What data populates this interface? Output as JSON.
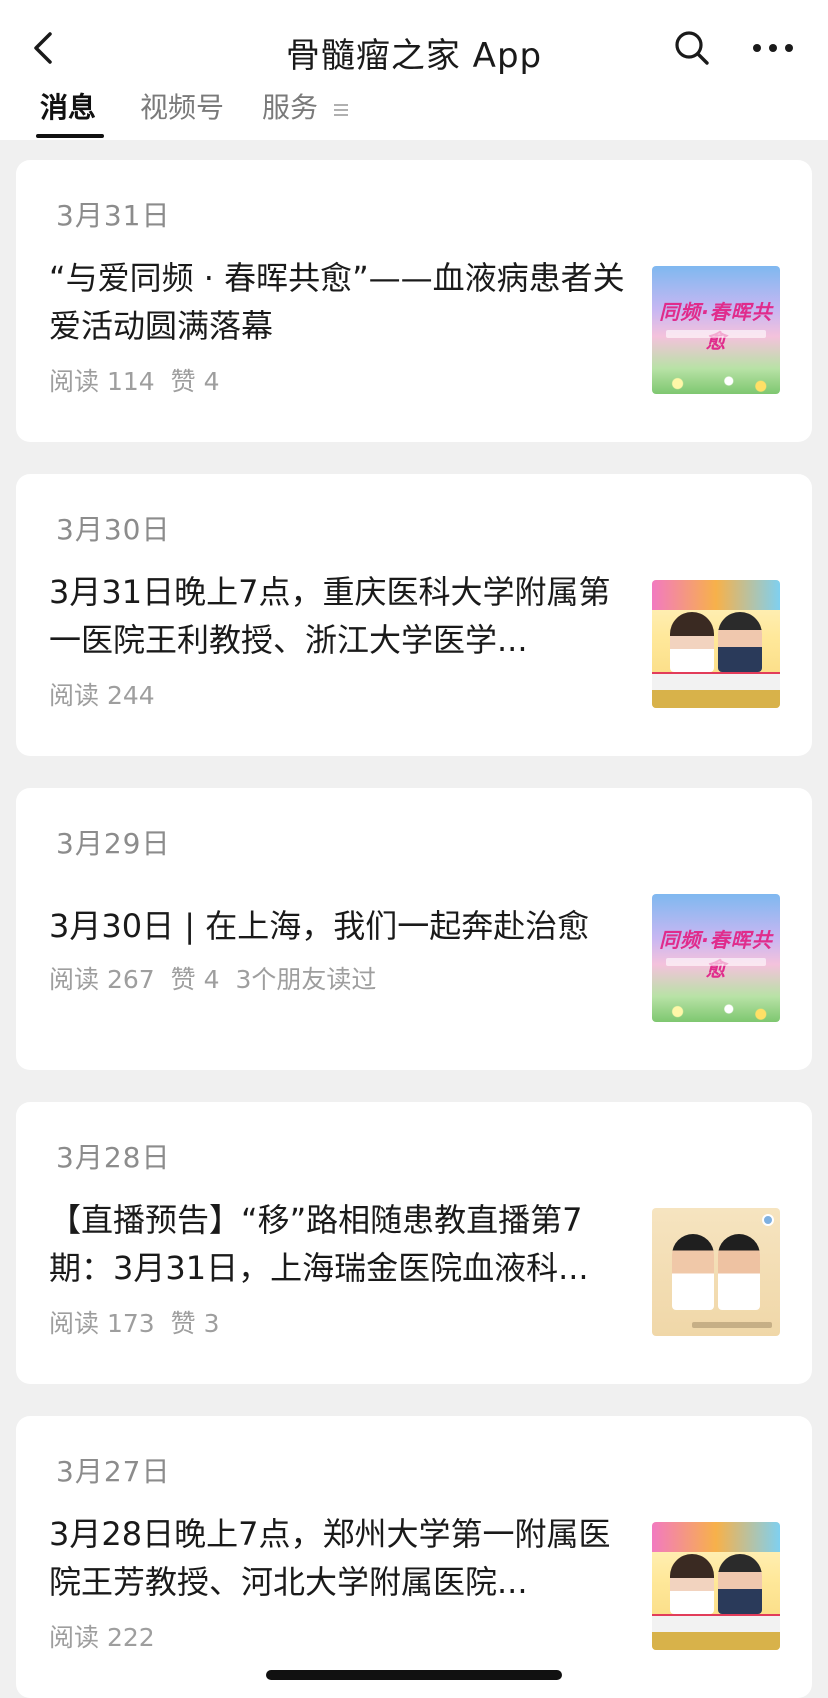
{
  "header": {
    "title": "骨髓瘤之家 App",
    "back_icon": "chevron-left-icon",
    "search_icon": "search-icon",
    "more_icon": "more-horizontal-icon"
  },
  "tabs": [
    {
      "label": "消息",
      "active": true
    },
    {
      "label": "视频号",
      "active": false
    },
    {
      "label": "服务",
      "active": false
    }
  ],
  "articles": [
    {
      "date": "3月31日",
      "title": "“与爱同频 · 春晖共愈”——血液病患者关爱活动圆满落幕",
      "reads": "阅读 114",
      "likes": "赞 4",
      "friends": "",
      "thumb_text": "同频·春晖共愈"
    },
    {
      "date": "3月30日",
      "title": "3月31日晚上7点，重庆医科大学附属第一医院王利教授、浙江大学医学...",
      "reads": "阅读 244",
      "likes": "",
      "friends": ""
    },
    {
      "date": "3月29日",
      "title": "3月30日 | 在上海，我们一起奔赴治愈",
      "reads": "阅读 267",
      "likes": "赞 4",
      "friends": "3个朋友读过",
      "thumb_text": "同频·春晖共愈"
    },
    {
      "date": "3月28日",
      "title": "【直播预告】“移”路相随患教直播第7期：3月31日，上海瑞金医院血液科...",
      "reads": "阅读 173",
      "likes": "赞 3",
      "friends": ""
    },
    {
      "date": "3月27日",
      "title": "3月28日晚上7点，郑州大学第一附属医院王芳教授、河北大学附属医院...",
      "reads": "阅读 222",
      "likes": "",
      "friends": ""
    }
  ]
}
